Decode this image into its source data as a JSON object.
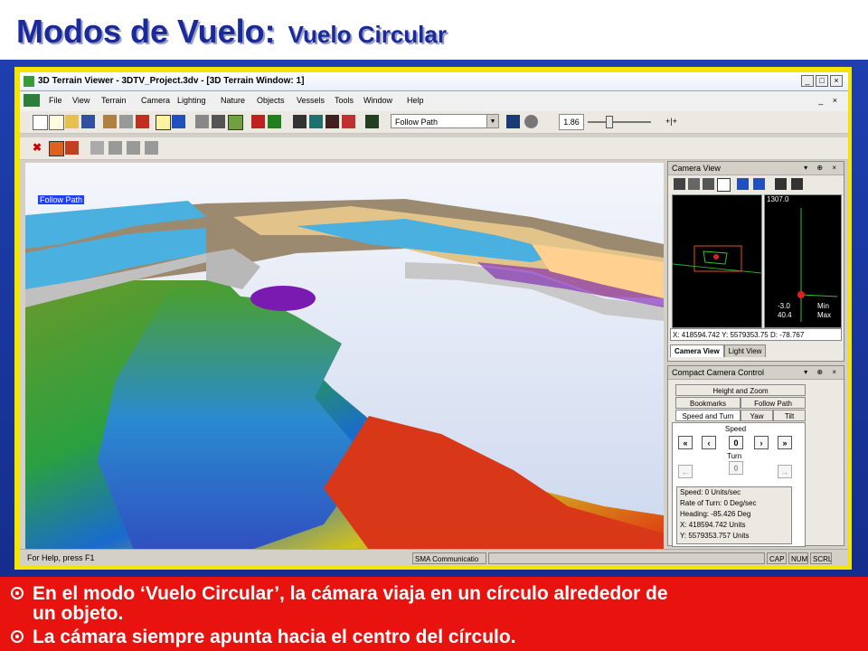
{
  "slide": {
    "title": "Modos de Vuelo:",
    "subtitle": "Vuelo Circular",
    "bullets": [
      "En el modo ‘Vuelo Circular’, la cámara viaja en un círculo alrededor de",
      "un objeto.",
      "La cámara siempre apunta hacia el centro del círculo."
    ]
  },
  "window": {
    "title": "3D Terrain Viewer - 3DTV_Project.3dv - [3D Terrain Window: 1]",
    "controls": [
      "_",
      "□",
      "×"
    ],
    "mdi_controls": "_ ×"
  },
  "menu": [
    "File",
    "View",
    "Terrain",
    "Camera",
    "Lighting",
    "Nature",
    "Objects",
    "Vessels",
    "Tools",
    "Window",
    "Help"
  ],
  "toolbar": {
    "flight_mode": "Follow Path",
    "zoom_value": "1.86",
    "end_button": "+|+"
  },
  "viewport": {
    "overlay_label": "Follow Path"
  },
  "camera_view": {
    "header": "Camera View",
    "elevation_top": "1307.0",
    "min_value": "-3.0",
    "min_label": "Min",
    "max_value": "40.4",
    "max_label": "Max",
    "coord_x": "X: 418594.742",
    "coord_y": "Y: 5579353.75",
    "coord_d": "D: -78.767",
    "tab_camera": "Camera View",
    "tab_light": "Light View"
  },
  "compact_camera": {
    "header": "Compact Camera Control",
    "tabs": {
      "height_zoom": "Height and Zoom",
      "bookmarks": "Bookmarks",
      "follow_path": "Follow Path",
      "speed_turn": "Speed and Turn",
      "yaw": "Yaw",
      "tilt": "Tilt"
    },
    "speed_label": "Speed",
    "turn_label": "Turn",
    "speed_value": "0",
    "turn_value": "0",
    "info": [
      "Speed: 0 Units/sec",
      "Rate of Turn: 0 Deg/sec",
      "Heading: -85.426 Deg",
      "X: 418594.742 Units",
      "Y: 5579353.757 Units"
    ]
  },
  "status": {
    "help": "For Help, press F1",
    "company": "SMA Communicatio",
    "cap": "CAP",
    "num": "NUM",
    "scrl": "SCRL"
  }
}
